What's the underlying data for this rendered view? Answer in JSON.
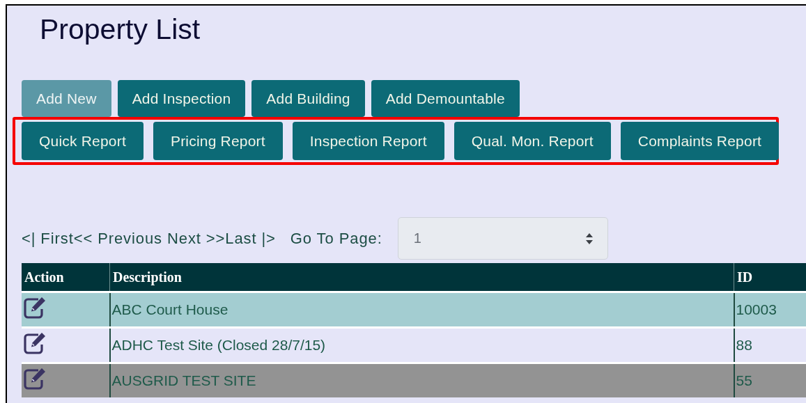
{
  "title": "Property List",
  "action_buttons": [
    {
      "label": "Add New",
      "disabled": true
    },
    {
      "label": "Add Inspection",
      "disabled": false
    },
    {
      "label": "Add Building",
      "disabled": false
    },
    {
      "label": "Add Demountable",
      "disabled": false
    }
  ],
  "report_buttons": {
    "highlighted": true,
    "buttons": [
      {
        "label": "Quick Report"
      },
      {
        "label": "Pricing Report"
      },
      {
        "label": "Inspection Report"
      },
      {
        "label": "Qual. Mon. Report"
      },
      {
        "label": "Complaints Report"
      }
    ]
  },
  "pagination": {
    "links": [
      "<| First",
      "<< Previous",
      "Next >>",
      "Last |>"
    ],
    "goto_label": "Go To Page:",
    "page_select": {
      "value": "1"
    }
  },
  "table": {
    "columns": [
      "Action",
      "Description",
      "ID"
    ],
    "rows": [
      {
        "description": "ABC Court House",
        "id": "10003",
        "selected": true,
        "greyed": false
      },
      {
        "description": "ADHC Test Site (Closed 28/7/15)",
        "id": "88",
        "selected": false,
        "greyed": false
      },
      {
        "description": "AUSGRID TEST SITE",
        "id": "55",
        "selected": false,
        "greyed": true
      }
    ]
  }
}
